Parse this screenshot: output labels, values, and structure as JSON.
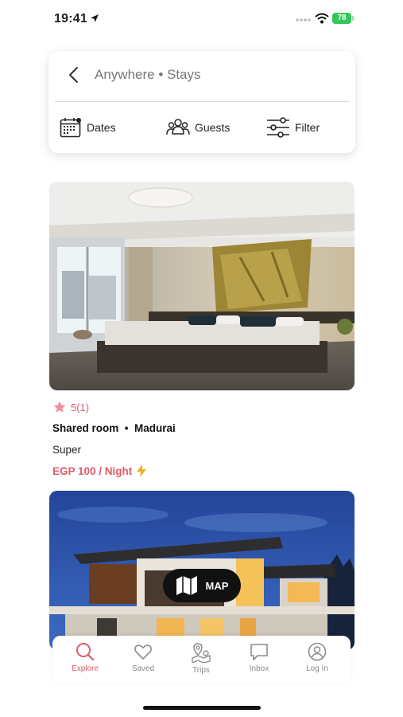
{
  "status": {
    "time": "19:41",
    "battery": "78"
  },
  "search": {
    "text": "Anywhere • Stays"
  },
  "filters": {
    "dates": "Dates",
    "guests": "Guests",
    "filter": "Filter"
  },
  "listing": {
    "rating": "5(1)",
    "title": "Shared room  •  Madurai",
    "subtitle": "Super",
    "price": "EGP 100 / Night"
  },
  "map_button": {
    "label": "MAP"
  },
  "tabs": [
    {
      "label": "Explore",
      "icon": "search-icon"
    },
    {
      "label": "Saved",
      "icon": "heart-icon"
    },
    {
      "label": "Trips",
      "icon": "map-pin-icon"
    },
    {
      "label": "Inbox",
      "icon": "message-icon"
    },
    {
      "label": "Log In",
      "icon": "user-icon"
    }
  ],
  "colors": {
    "accent": "#e05a6a",
    "battery": "#34c759"
  }
}
